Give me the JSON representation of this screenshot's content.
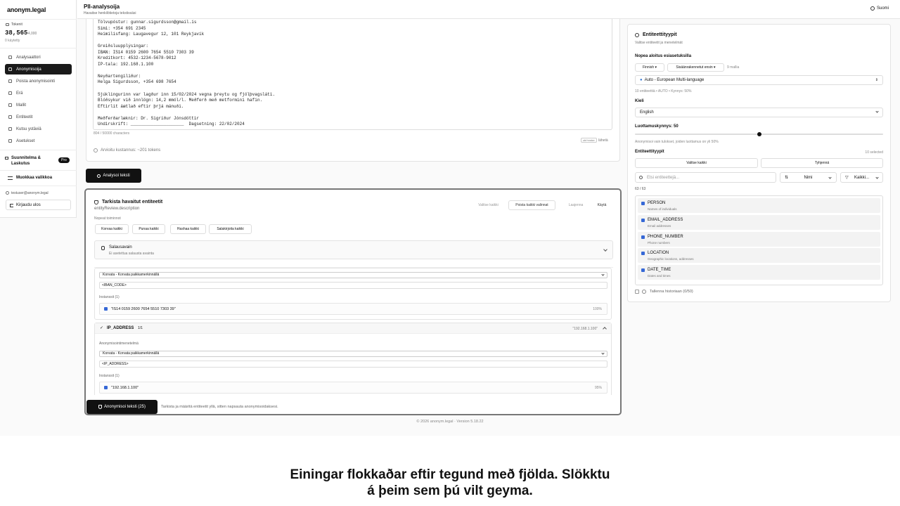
{
  "sidebar": {
    "brand": "anonym.legal",
    "tokens_label": "Tokenit",
    "tokens_value": "38,565",
    "tokens_of": "/ 4,000",
    "tokens_used": "0 käytetty",
    "nav": [
      {
        "label": "Analysaattori",
        "active": false
      },
      {
        "label": "Anonymisoija",
        "active": true
      },
      {
        "label": "Poista anonymisointi",
        "active": false
      },
      {
        "label": "Erä",
        "active": false
      },
      {
        "label": "Mallit",
        "active": false
      },
      {
        "label": "Entiteetit",
        "active": false
      },
      {
        "label": "Kutsu ystäviä",
        "active": false
      },
      {
        "label": "Asetukset",
        "active": false
      }
    ],
    "plan": "Suunnitelma & Laskutus",
    "plan_badge": "Pro",
    "edit_menu": "Muokkaa valikkoa",
    "user_email": "testuser@anonym.legal",
    "logout": "Kirjaudu ulos"
  },
  "header": {
    "title": "PII-analysoija",
    "subtitle": "Havaitse henkilötietoja tekstissäsi",
    "language": "Suomi"
  },
  "editor": {
    "lines": [
      "Tölvupóstur: gunnar.sigurdsson@gmail.is",
      "Sími: +354 691 2345",
      "Heimilisfang: Laugavegur 12, 101 Reykjavík",
      "",
      "Greiðsluupplýsingar:",
      "IBAN: IS14 0159 2600 7654 5510 7303 39",
      "Kreditkort: 4532-1234-5678-9012",
      "IP-tala: 192.168.1.100",
      "",
      "Neyðartengiliður:",
      "Helga Sigurdsson, +354 698 7654",
      "",
      "Sjúklingurinn var lagður inn 15/02/2024 vegna þreytu og fjölþvagsláti.",
      "Blóðsykur við innlögn: 14,2 mmól/l. Meðferð með metformini hafin.",
      "Eftirlit áætlað eftir þrjá mánuði.",
      "",
      "Meðferðarlæknir: Dr. Sigríður Jónsdóttir",
      "Undirskrift: _____________________  Dagsetning: 22/02/2024"
    ],
    "char_count": "804 / 50000 characters",
    "shortcut_badge": "ctrl+enter",
    "shortcut_text": "lähetä",
    "cost": "Arvioitu kustannus: ~201 tokens",
    "analyze_button": "Analysoi teksti"
  },
  "review": {
    "title": "Tarkista havaitut entiteetit",
    "description": "entityReview.description",
    "select_all": "Valitse kaikki",
    "deselect_all": "Poista kaikki valinnat",
    "expand": "Laajenna",
    "collapse": "Käytä",
    "quick_actions_label": "Nopeat toiminnot",
    "quick_actions": [
      "Korvaa kaikki",
      "Punaa kaikki",
      "Hashaa kaikki",
      "Salakirjoita kaikki"
    ],
    "salt_title": "Salausavain",
    "salt_sub": "Ei asetettua salausta avainta",
    "iban_entity": {
      "method": "Korvata - Korvata paikkamerkinnällä",
      "replacement": "<IBAN_CODE>",
      "instances_label": "Instanssit (1)",
      "instance_value": "\"IS14 0159 2600 7654 5510 7303 39\"",
      "instance_pct": "100%"
    },
    "ip_entity": {
      "name": "IP_ADDRESS",
      "count": "1/1",
      "preview": "\"192.168.1.100\"",
      "method_label": "Anonymisointimenetelmä",
      "method": "Korvata - Korvata paikkamerkinnällä",
      "replacement": "<IP_ADDRESS>",
      "instances_label": "Instanssit (1)",
      "instance_value": "\"192.168.1.100\"",
      "instance_pct": "95%"
    },
    "anonymize_button": "Anonymisoi teksti (25)",
    "anonymize_hint": "Tarkista ja määritä entiteetit yllä, sitten napsauta anonymisoidaksesi."
  },
  "entity_panel": {
    "title": "Entiteettityypit",
    "subtitle": "Valitse entiteetit ja menetelmät",
    "quick_start_label": "Nopea aloitus esiasetuksilla",
    "preset_lang": "Finnish",
    "preset_builtin": "Sisäänrakennetut ensin",
    "preset_count": "9 mallia",
    "preset_select": "Auto - European Multi-language",
    "preset_info": "10 entiteettiä • AUTO • Kynnys: 50%",
    "language_label": "Kieli",
    "language_value": "English",
    "threshold_label": "Luottamuskynnys: 50",
    "threshold_value": 0.5,
    "threshold_hint": "Anonymisoi vain tulokset, joiden luottamus on yli 50%",
    "types_label": "Entiteettityypit",
    "types_selected": "10 selected",
    "select_all": "Valitse kaikki",
    "clear": "Tyhjennä",
    "search_placeholder": "Etsi entiteettejä...",
    "sort": "Nimi",
    "filter": "Kaikki...",
    "count": "63 / 63",
    "types": [
      {
        "name": "PERSON",
        "desc": "Names of individuals"
      },
      {
        "name": "EMAIL_ADDRESS",
        "desc": "Email addresses"
      },
      {
        "name": "PHONE_NUMBER",
        "desc": "Phone numbers"
      },
      {
        "name": "LOCATION",
        "desc": "Geographic locations, addresses"
      },
      {
        "name": "DATE_TIME",
        "desc": "Dates and times"
      }
    ],
    "save_history": "Tallenna historiaan (0/50)"
  },
  "footer": "© 2026 anonym.legal · Version 5.18.22",
  "caption_line1": "Einingar flokkaðar eftir tegund með fjölda. Slökktu",
  "caption_line2": "á þeim sem þú vilt geyma."
}
